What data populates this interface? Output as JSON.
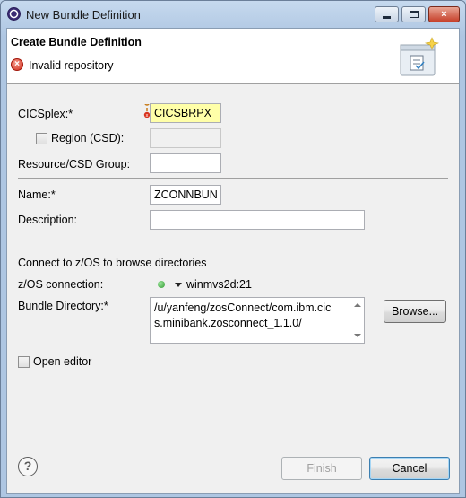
{
  "window": {
    "title": "New Bundle Definition",
    "controls": {
      "close_glyph": "×"
    }
  },
  "header": {
    "title": "Create Bundle Definition",
    "error_glyph": "×",
    "message": "Invalid repository"
  },
  "form": {
    "cicsplex": {
      "label": "CICSplex:",
      "required": "*",
      "value": "CICSBRPX"
    },
    "region": {
      "label": "Region (CSD):",
      "value": "",
      "checked": false
    },
    "resource_group": {
      "label": "Resource/CSD Group:",
      "value": ""
    },
    "name": {
      "label": "Name:",
      "required": "*",
      "value": "ZCONNBUN"
    },
    "description": {
      "label": "Description:",
      "value": ""
    },
    "connect_heading": "Connect to z/OS to browse directories",
    "zos_connection": {
      "label": "z/OS connection:",
      "value": "winmvs2d:21",
      "status_color": "#2f9a2f"
    },
    "bundle_directory": {
      "label": "Bundle Directory:",
      "required": "*",
      "line1": "/u/yanfeng/zosConnect/com.ibm.cic",
      "line2": "s.minibank.zosconnect_1.1.0/"
    },
    "browse_label": "Browse...",
    "open_editor": {
      "label": "Open editor",
      "checked": false
    }
  },
  "footer": {
    "help_glyph": "?",
    "finish_label": "Finish",
    "cancel_label": "Cancel"
  },
  "colors": {
    "highlight_field": "#ffffa8",
    "error": "#d02a1a"
  }
}
